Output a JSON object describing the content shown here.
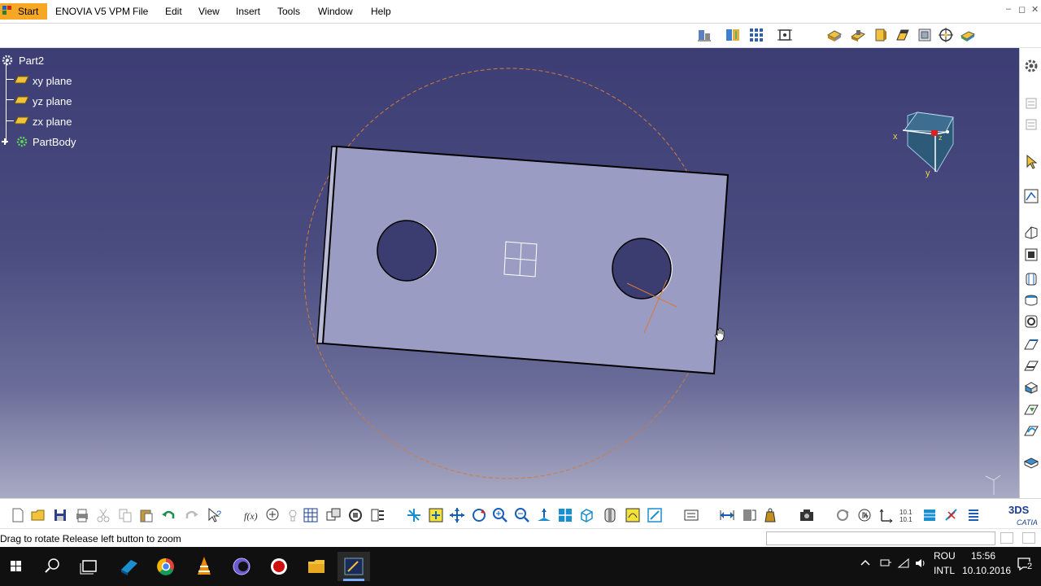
{
  "menubar": {
    "start": "Start",
    "items": [
      "ENOVIA V5 VPM",
      "File",
      "Edit",
      "View",
      "Insert",
      "Tools",
      "Window",
      "Help"
    ],
    "window_controls": [
      "–",
      "◻",
      "✕"
    ]
  },
  "tree": {
    "root": "Part2",
    "items": [
      "xy plane",
      "yz plane",
      "zx plane",
      "PartBody"
    ]
  },
  "compass": {
    "x_label": "x",
    "y_label": "y",
    "z_label": "z"
  },
  "statusbar": {
    "message": "Drag to rotate  Release left button to zoom",
    "command_value": ""
  },
  "taskbar": {
    "apps": [
      "windows-start",
      "search",
      "task-view",
      "catia-v5",
      "chrome",
      "vlc",
      "eclipse",
      "screen-recorder",
      "file-explorer",
      "catia-active"
    ],
    "language_top": "ROU",
    "language_bottom": "INTL",
    "time": "15:56",
    "date": "10.10.2016",
    "notification_count": "2"
  },
  "colors": {
    "viewport_top": "#3c3d74",
    "viewport_bottom": "#a9aac4",
    "part_face": "#9a9cc3",
    "start_orange": "#f6a825",
    "trajectory_orange": "#d47a3a"
  }
}
